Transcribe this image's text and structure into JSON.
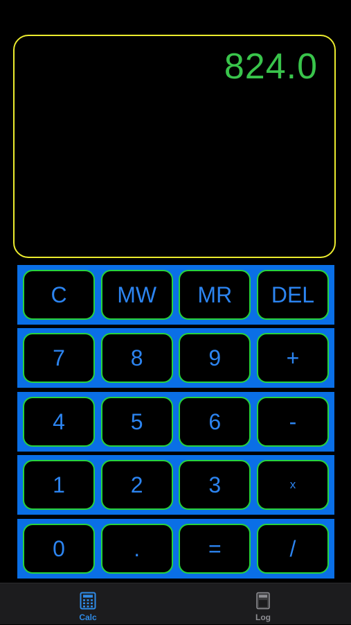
{
  "display": {
    "value": "824.0"
  },
  "keypad": {
    "rows": [
      [
        "C",
        "MW",
        "MR",
        "DEL"
      ],
      [
        "7",
        "8",
        "9",
        "+"
      ],
      [
        "4",
        "5",
        "6",
        "-"
      ],
      [
        "1",
        "2",
        "3",
        "x"
      ],
      [
        "0",
        ".",
        "=",
        "/"
      ]
    ]
  },
  "tabbar": {
    "tabs": [
      {
        "label": "Calc",
        "icon": "calculator-icon",
        "active": true
      },
      {
        "label": "Log",
        "icon": "log-icon",
        "active": false
      }
    ]
  },
  "colors": {
    "background": "#000000",
    "display_border": "#ecec2e",
    "display_text": "#39c44b",
    "row_background": "#0a6fe6",
    "key_border": "#27d33c",
    "key_text": "#2c84f0",
    "tab_active": "#2f8be6",
    "tab_inactive": "#8e8e93"
  }
}
